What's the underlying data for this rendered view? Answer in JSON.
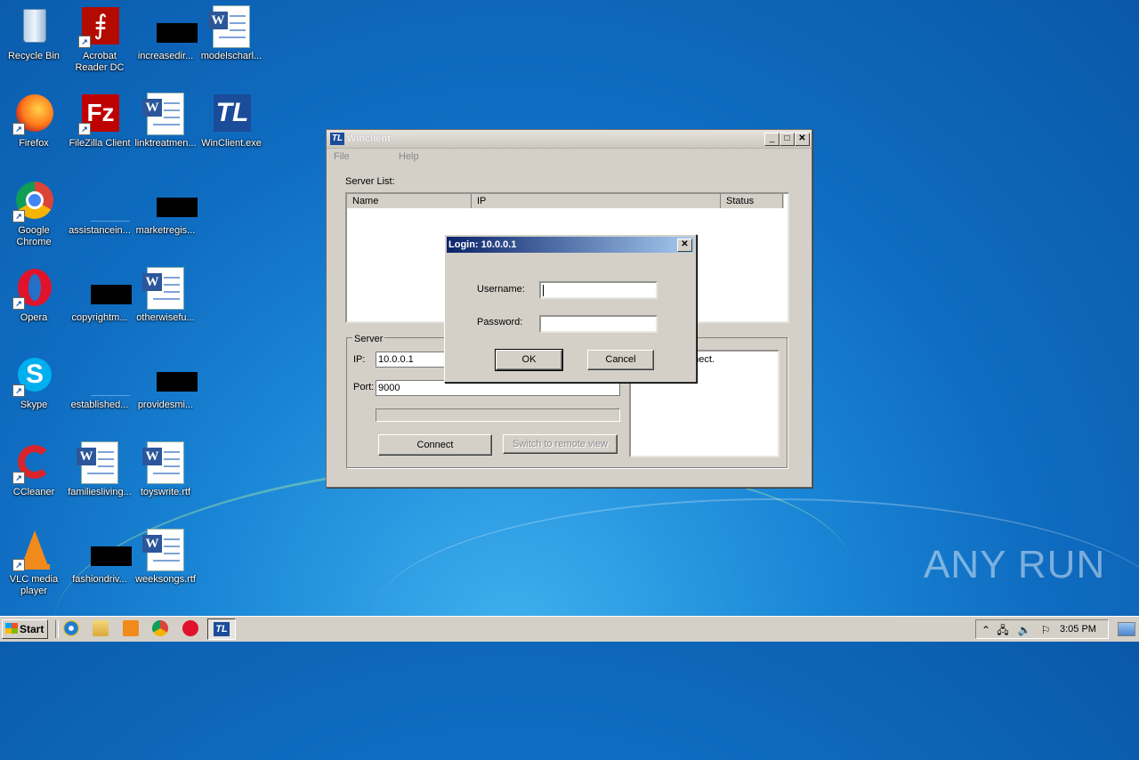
{
  "desktop": {
    "icons": [
      {
        "label": "Recycle Bin"
      },
      {
        "label": "Acrobat Reader DC"
      },
      {
        "label": "increasedir..."
      },
      {
        "label": "modelscharl..."
      },
      {
        "label": "Firefox"
      },
      {
        "label": "FileZilla Client"
      },
      {
        "label": "linktreatmen..."
      },
      {
        "label": "WinClient.exe"
      },
      {
        "label": "Google Chrome"
      },
      {
        "label": "assistancein..."
      },
      {
        "label": "marketregis..."
      },
      {
        "label": "Opera"
      },
      {
        "label": "copyrightm..."
      },
      {
        "label": "otherwisefu..."
      },
      {
        "label": "Skype"
      },
      {
        "label": "established..."
      },
      {
        "label": "providesmi..."
      },
      {
        "label": "CCleaner"
      },
      {
        "label": "familiesliving..."
      },
      {
        "label": "toyswrite.rtf"
      },
      {
        "label": "VLC media player"
      },
      {
        "label": "fashiondriv..."
      },
      {
        "label": "weeksongs.rtf"
      }
    ],
    "watermark": "ANY RUN"
  },
  "window": {
    "title": "Winclient",
    "menu": [
      "File",
      "Help"
    ],
    "server_list_label": "Server List:",
    "columns": [
      "Name",
      "IP",
      "Status"
    ],
    "server_group_label": "Server",
    "ip_label": "IP:",
    "ip_value": "10.0.0.1",
    "port_label": "Port:",
    "port_value": "9000",
    "connect_label": "Connect",
    "switch_label": "Switch to remote view",
    "log_text": "nnect."
  },
  "dialog": {
    "title": "Login: 10.0.0.1",
    "username_label": "Username:",
    "username_value": "",
    "password_label": "Password:",
    "password_value": "",
    "ok_label": "OK",
    "cancel_label": "Cancel"
  },
  "taskbar": {
    "start_label": "Start",
    "clock": "3:05 PM"
  }
}
